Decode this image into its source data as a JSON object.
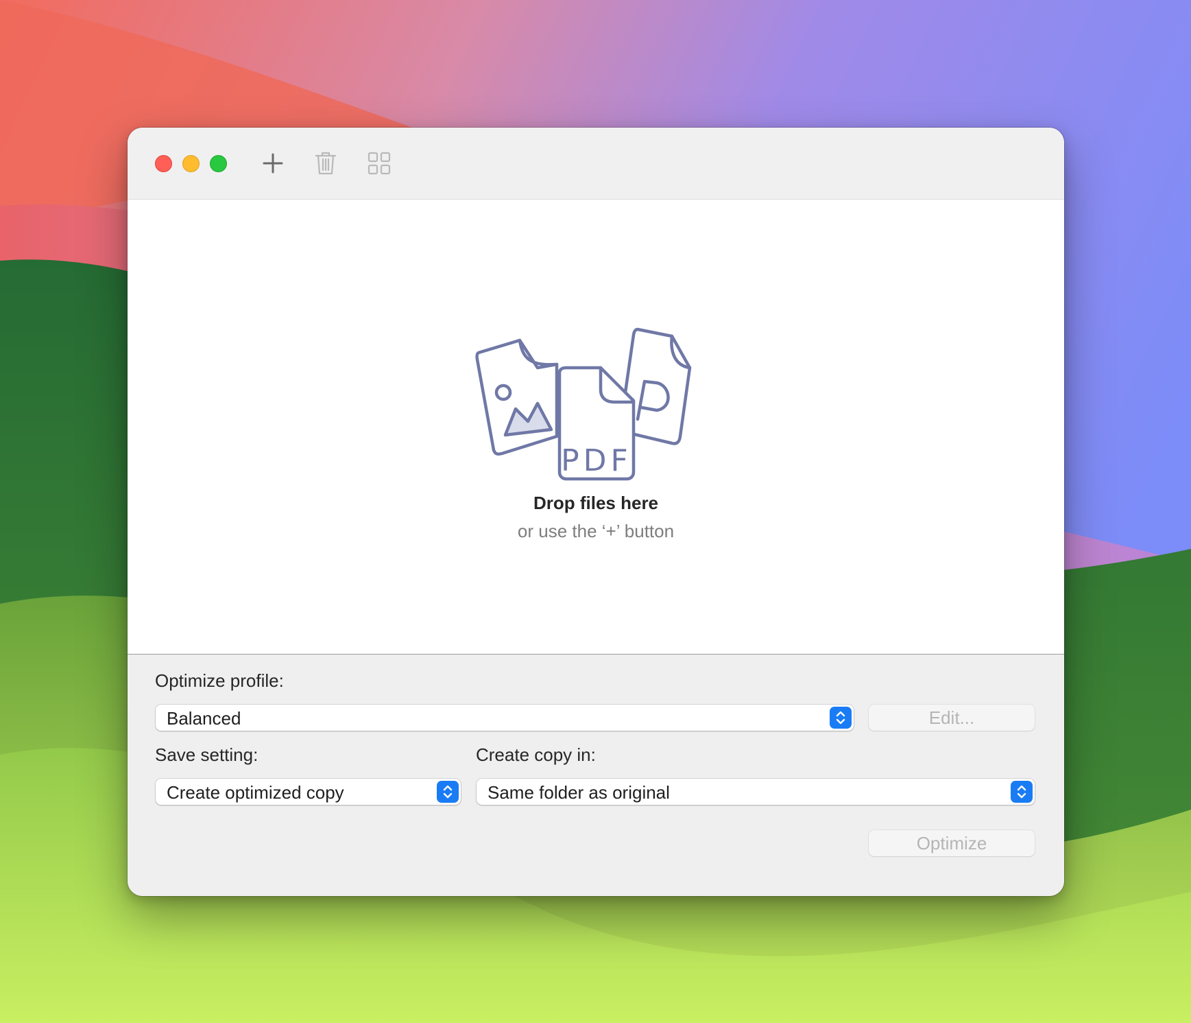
{
  "dropzone": {
    "title": "Drop files here",
    "subtitle": "or use the ‘+’ button",
    "illustration_icons": [
      "image-file-icon",
      "pdf-file-icon",
      "presentation-file-icon"
    ],
    "illustration_text": "PDF"
  },
  "toolbar": {
    "items": [
      "add-icon",
      "trash-icon",
      "grid-icon"
    ]
  },
  "controls": {
    "optimize_profile_label": "Optimize profile:",
    "optimize_profile_value": "Balanced",
    "edit_button": "Edit...",
    "save_setting_label": "Save setting:",
    "save_setting_value": "Create optimized copy",
    "create_copy_label": "Create copy in:",
    "create_copy_value": "Same folder as original",
    "optimize_button": "Optimize"
  },
  "colors": {
    "accent": "#1a7cf5",
    "illustration_stroke": "#6f78a6",
    "close": "#ff5f57",
    "minimize": "#febc2e",
    "maximize": "#28c840"
  }
}
